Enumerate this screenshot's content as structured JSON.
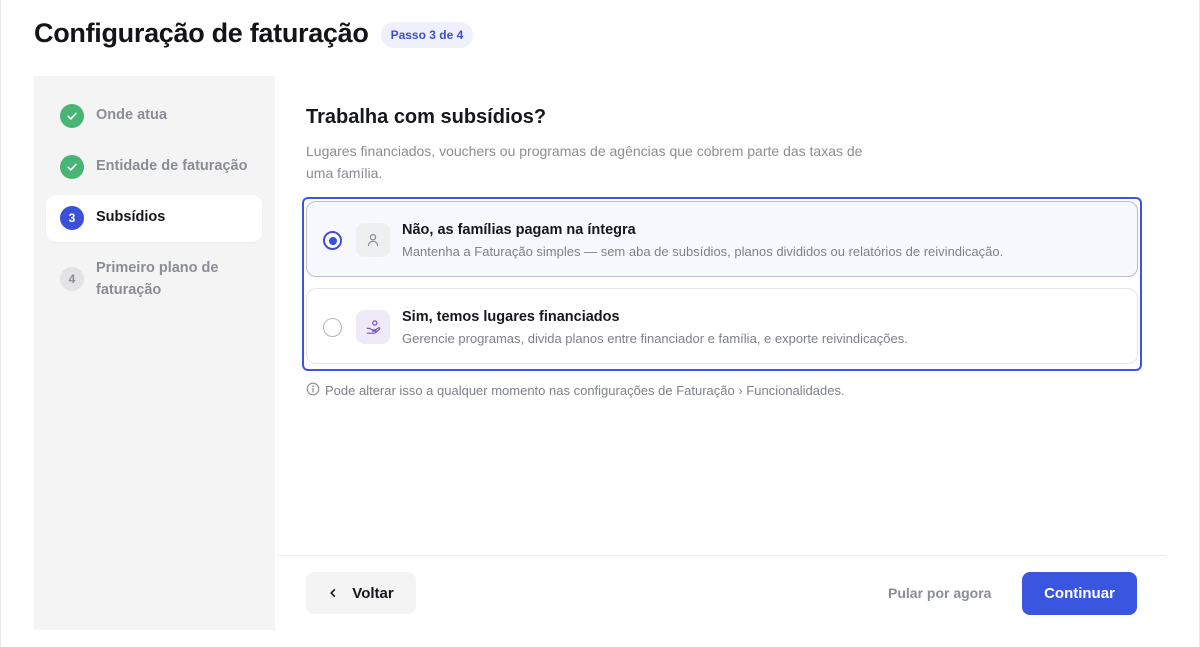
{
  "header": {
    "title": "Configuração de faturação",
    "step_badge": "Passo 3 de 4"
  },
  "sidebar": {
    "steps": [
      {
        "label": "Onde atua",
        "state": "done",
        "marker": ""
      },
      {
        "label": "Entidade de faturação",
        "state": "done",
        "marker": ""
      },
      {
        "label": "Subsídios",
        "state": "active",
        "marker": "3"
      },
      {
        "label": "Primeiro plano de faturação",
        "state": "todo",
        "marker": "4"
      }
    ]
  },
  "main": {
    "question": "Trabalha com subsídios?",
    "description": "Lugares financiados, vouchers ou programas de agências que cobrem parte das taxas de uma família.",
    "options": [
      {
        "title": "Não, as famílias pagam na íntegra",
        "description": "Mantenha a Faturação simples — sem aba de subsídios, planos divididos ou relatórios de reivindicação.",
        "icon": "person-icon",
        "selected": true
      },
      {
        "title": "Sim, temos lugares financiados",
        "description": "Gerencie programas, divida planos entre financiador e família, e exporte reivindicações.",
        "icon": "hand-coin-icon",
        "selected": false
      }
    ],
    "hint": "Pode alterar isso a qualquer momento nas configurações de Faturação › Funcionalidades."
  },
  "footer": {
    "back_label": "Voltar",
    "skip_label": "Pular por agora",
    "continue_label": "Continuar"
  },
  "colors": {
    "accent": "#3a56e0",
    "done": "#48b574"
  }
}
